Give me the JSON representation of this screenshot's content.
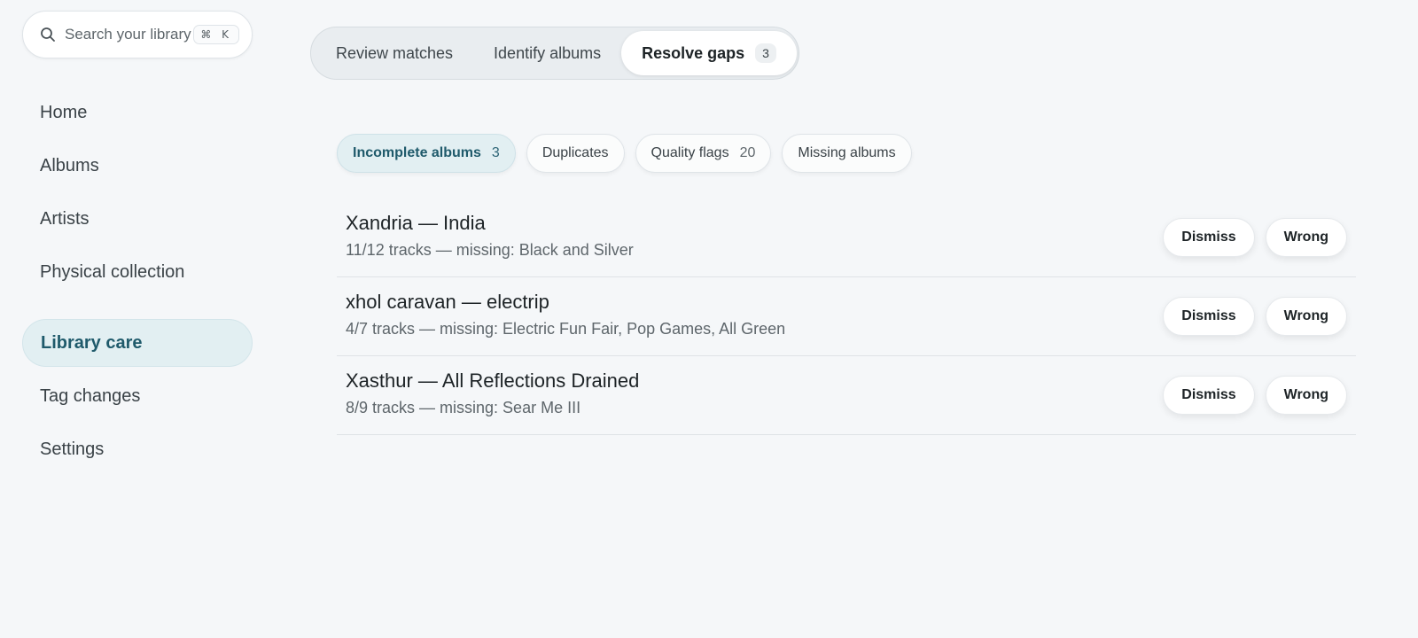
{
  "sidebar": {
    "search": {
      "placeholder": "Search your library",
      "shortcut": "⌘ K",
      "icon": "search-icon"
    },
    "items": [
      {
        "label": "Home"
      },
      {
        "label": "Albums"
      },
      {
        "label": "Artists"
      },
      {
        "label": "Physical collection"
      },
      {
        "label": "Library care",
        "active": true
      },
      {
        "label": "Tag changes"
      },
      {
        "label": "Settings"
      }
    ]
  },
  "tabs": {
    "review": {
      "label": "Review matches"
    },
    "identify": {
      "label": "Identify albums"
    },
    "resolve": {
      "label": "Resolve gaps",
      "count": "3",
      "active": true
    }
  },
  "filters": {
    "incomplete": {
      "label": "Incomplete albums",
      "count": "3",
      "active": true
    },
    "duplicates": {
      "label": "Duplicates"
    },
    "quality": {
      "label": "Quality flags",
      "count": "20"
    },
    "missing": {
      "label": "Missing albums"
    }
  },
  "gaps": [
    {
      "title": "Xandria — India",
      "detail": "11/12 tracks — missing: Black and Silver",
      "dismiss_label": "Dismiss",
      "wrong_label": "Wrong"
    },
    {
      "title": "xhol caravan — electrip",
      "detail": "4/7 tracks — missing: Electric Fun Fair, Pop Games, All Green",
      "dismiss_label": "Dismiss",
      "wrong_label": "Wrong"
    },
    {
      "title": "Xasthur — All Reflections Drained",
      "detail": "8/9 tracks — missing: Sear Me III",
      "dismiss_label": "Dismiss",
      "wrong_label": "Wrong"
    }
  ],
  "colors": {
    "background": "#f5f7f9",
    "accent": "#1f5a6b",
    "accent_bg": "#e2eff2",
    "text": "#1d2326",
    "muted": "#5e666b"
  }
}
